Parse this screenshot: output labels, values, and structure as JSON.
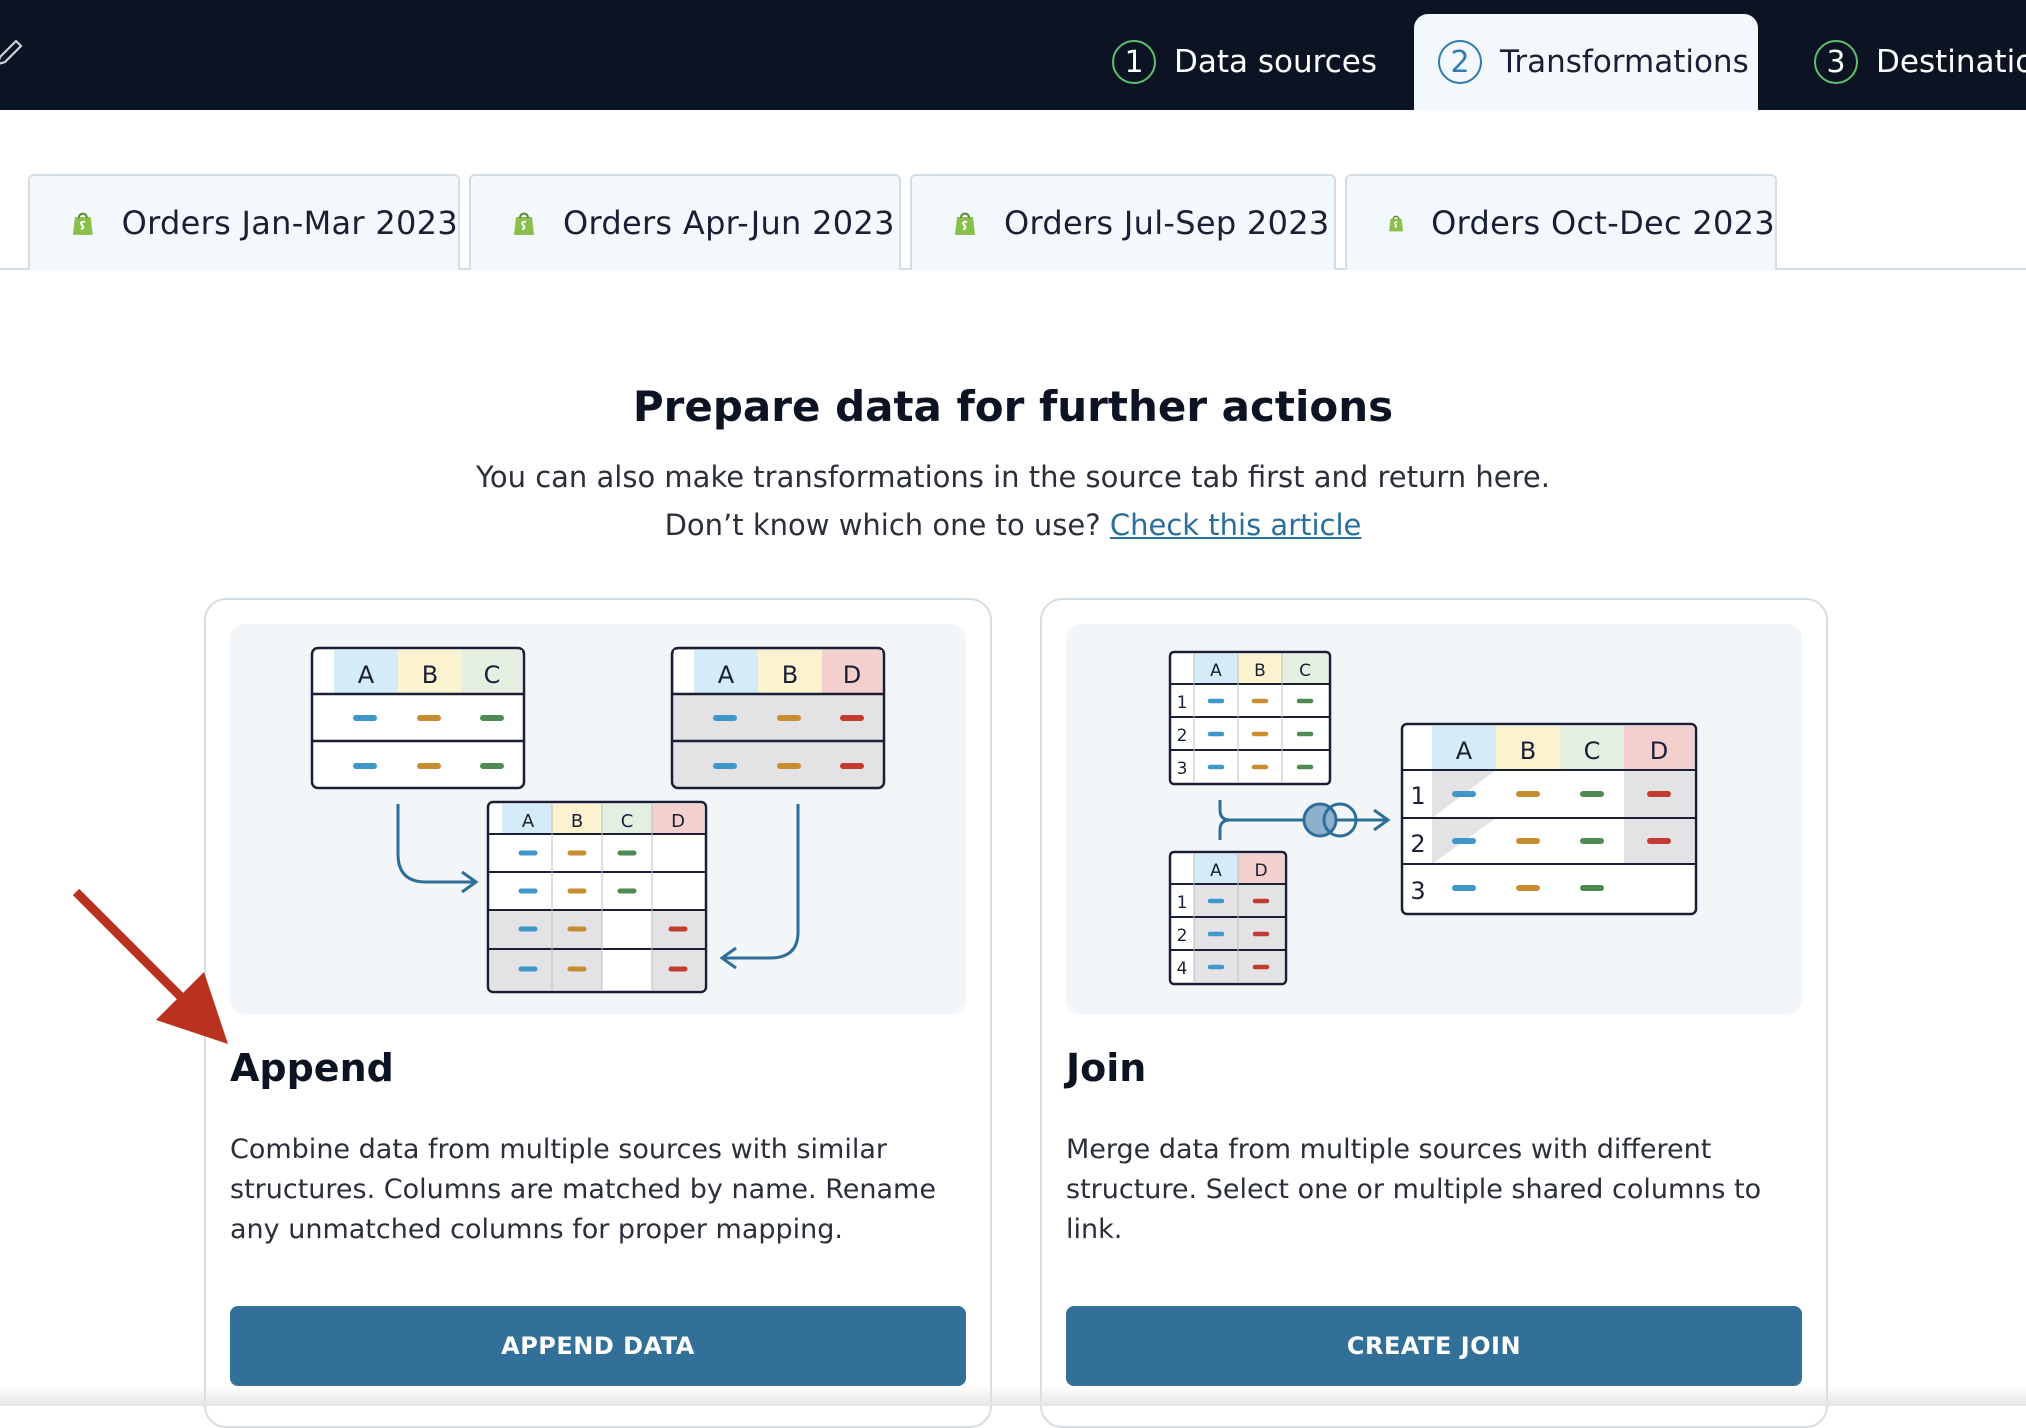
{
  "stepper": {
    "steps": [
      {
        "number": "1",
        "label": "Data sources"
      },
      {
        "number": "2",
        "label": "Transformations"
      },
      {
        "number": "3",
        "label": "Destinatio"
      }
    ]
  },
  "source_tabs": [
    {
      "label": "Orders Jan-Mar 2023",
      "icon": "shopify-icon"
    },
    {
      "label": "Orders Apr-Jun 2023",
      "icon": "shopify-icon"
    },
    {
      "label": "Orders Jul-Sep 2023",
      "icon": "shopify-icon"
    },
    {
      "label": "Orders Oct-Dec 2023",
      "icon": "shopify-icon"
    }
  ],
  "main": {
    "title": "Prepare data for further actions",
    "subtitle": "You can also make transformations in the source tab first and return here.",
    "help_prefix": "Don’t know which one to use? ",
    "help_link": "Check this article"
  },
  "cards": {
    "append": {
      "title": "Append",
      "description": "Combine data from multiple sources with similar structures. Columns are matched by name. Rename any unmatched columns for proper mapping.",
      "button": "APPEND DATA"
    },
    "join": {
      "title": "Join",
      "description": "Merge data from multiple sources with different structure. Select one or multiple shared columns to link.",
      "button": "CREATE JOIN"
    }
  },
  "illustration_labels": {
    "col_a": "A",
    "col_b": "B",
    "col_c": "C",
    "col_d": "D",
    "row_1": "1",
    "row_2": "2",
    "row_3": "3",
    "row_4": "4"
  },
  "colors": {
    "topbar": "#0c1424",
    "accent": "#337099",
    "link": "#2a6e9a",
    "step_circle": "#5fbf6f",
    "annotation_arrow": "#b8321f",
    "col_a": "#d4ecf7",
    "col_b": "#fbf3d0",
    "col_c": "#e4efe2",
    "col_d": "#f3cfcd"
  }
}
